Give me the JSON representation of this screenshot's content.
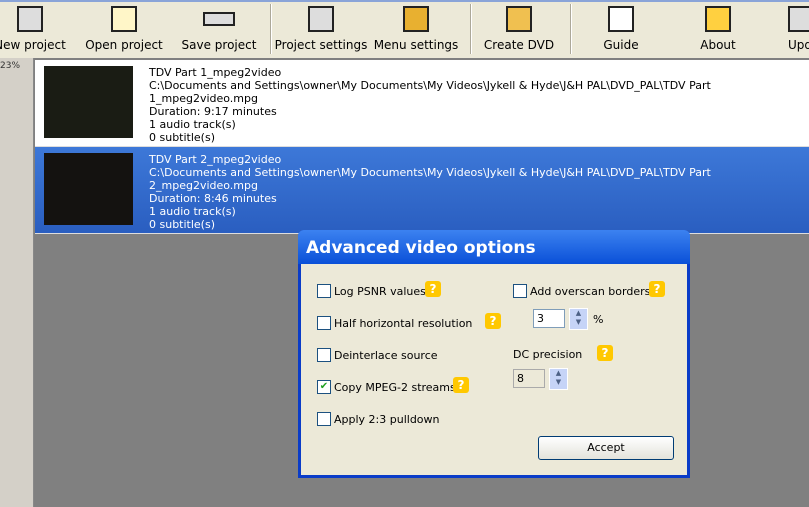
{
  "toolbar": [
    {
      "label": "New project",
      "icon": "film-icon"
    },
    {
      "label": "Open project",
      "icon": "folder-icon"
    },
    {
      "label": "Save project",
      "icon": "drive-icon"
    },
    {
      "label": "Project settings",
      "icon": "settings-icon"
    },
    {
      "label": "Menu settings",
      "icon": "menu-icon"
    },
    {
      "label": "Create DVD",
      "icon": "gears-icon"
    },
    {
      "label": "Guide",
      "icon": "info-icon"
    },
    {
      "label": "About",
      "icon": "about-icon"
    },
    {
      "label": "Update",
      "icon": "update-icon"
    }
  ],
  "progress": "23%",
  "items": [
    {
      "title": "TDV  Part 1_mpeg2video",
      "path": "C:\\Documents and Settings\\owner\\My Documents\\My Videos\\Jykell & Hyde\\J&H PAL\\DVD_PAL\\TDV  Part 1_mpeg2video.mpg",
      "duration": "Duration: 9:17 minutes",
      "audio": "1 audio track(s)",
      "subs": "0 subtitle(s)"
    },
    {
      "title": "TDV Part 2_mpeg2video",
      "path": "C:\\Documents and Settings\\owner\\My Documents\\My Videos\\Jykell & Hyde\\J&H PAL\\DVD_PAL\\TDV Part 2_mpeg2video.mpg",
      "duration": "Duration: 8:46 minutes",
      "audio": "1 audio track(s)",
      "subs": "0 subtitle(s)"
    }
  ],
  "dialog": {
    "title": "Advanced video options",
    "log_psnr": "Log PSNR values",
    "half_res": "Half horizontal resolution",
    "deinterlace": "Deinterlace source",
    "copy_mpeg2": "Copy MPEG-2 streams",
    "pulldown": "Apply 2:3 pulldown",
    "overscan": "Add overscan borders",
    "overscan_value": "3",
    "percent": "%",
    "dc_label": "DC precision",
    "dc_value": "8",
    "help": "?",
    "check": "✔",
    "accept": "Accept"
  }
}
